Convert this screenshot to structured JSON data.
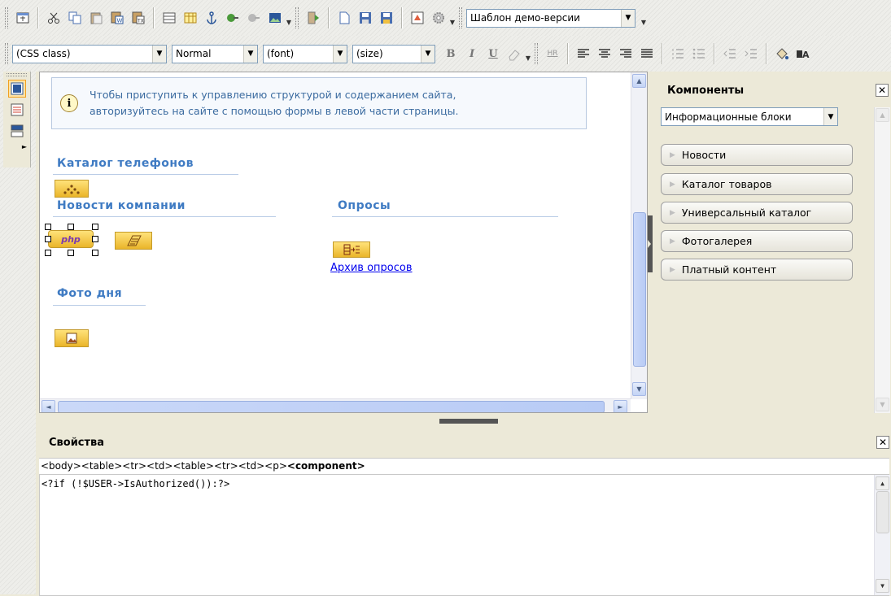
{
  "toolbar1": {
    "template_select": {
      "value": "Шаблон демо-версии"
    }
  },
  "toolbar2": {
    "css_class_select": {
      "value": "(CSS class)"
    },
    "format_select": {
      "value": "Normal"
    },
    "font_select": {
      "value": "(font)"
    },
    "size_select": {
      "value": "(size)"
    },
    "bold_label": "B",
    "italic_label": "I",
    "underline_label": "U",
    "hr_label": "HR"
  },
  "editor": {
    "notice": {
      "line1": "Чтобы приступить к управлению структурой и содержанием сайта,",
      "line2": "авторизуйтесь на сайте с помощью формы в левой части страницы."
    },
    "blocks": {
      "catalog_title": "Каталог телефонов",
      "news_title": "Новости компании",
      "polls_title": "Опросы",
      "photo_title": "Фото дня"
    },
    "php_label": "php",
    "archive_link": "Архив опросов"
  },
  "components": {
    "title": "Компоненты",
    "category_select": {
      "value": "Информационные блоки"
    },
    "items": [
      {
        "label": "Новости"
      },
      {
        "label": "Каталог товаров"
      },
      {
        "label": "Универсальный каталог"
      },
      {
        "label": "Фотогалерея"
      },
      {
        "label": "Платный контент"
      }
    ]
  },
  "properties": {
    "title": "Свойства",
    "tag_path_prefix": "<body><table><tr><td><table><tr><td><p>",
    "tag_path_current": "<component>",
    "code": "<?if (!$USER->IsAuthorized()):?>"
  },
  "colors": {
    "accent_blue": "#3f7bc3",
    "link": "#0000ee",
    "component_gold": "#eab52a"
  }
}
